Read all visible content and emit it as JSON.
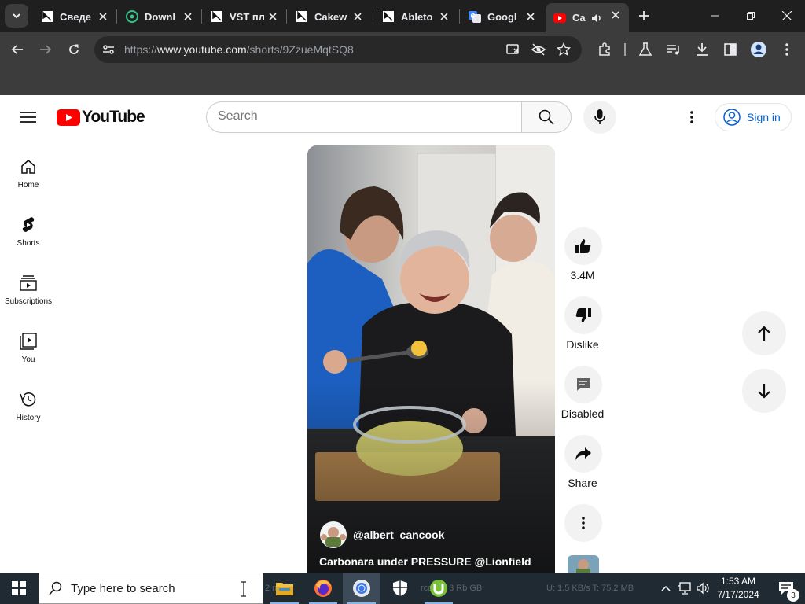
{
  "browser": {
    "tabs": [
      {
        "label": "Сведе",
        "icon": "cursor-app-icon"
      },
      {
        "label": "Downl",
        "icon": "green-circle-icon"
      },
      {
        "label": "VST пл",
        "icon": "cursor-app-icon"
      },
      {
        "label": "Cakew",
        "icon": "cursor-app-icon"
      },
      {
        "label": "Ableto",
        "icon": "cursor-app-icon"
      },
      {
        "label": "Googl",
        "icon": "google-translate-icon"
      },
      {
        "label": "Car",
        "icon": "youtube-icon",
        "active": true,
        "audio": true
      }
    ],
    "url_scheme": "https://",
    "url_host": "www.youtube.com",
    "url_path": "/shorts/9ZzueMqtSQ8"
  },
  "youtube": {
    "logo_text": "YouTube",
    "search_placeholder": "Search",
    "sign_in_label": "Sign in",
    "nav": [
      {
        "label": "Home",
        "icon": "home-icon"
      },
      {
        "label": "Shorts",
        "icon": "shorts-icon"
      },
      {
        "label": "Subscriptions",
        "icon": "subscriptions-icon"
      },
      {
        "label": "You",
        "icon": "you-icon"
      },
      {
        "label": "History",
        "icon": "history-icon"
      }
    ],
    "short": {
      "channel": "@albert_cancook",
      "title": "Carbonara under PRESSURE @Lionfield"
    },
    "actions": {
      "likes": "3.4M",
      "dislike": "Dislike",
      "comments": "Disabled",
      "share": "Share"
    }
  },
  "taskbar": {
    "search_placeholder": "Type here to search",
    "time": "1:53 AM",
    "date": "7/17/2024",
    "notification_count": "3",
    "ghost_left": "2 m",
    "ghost_mid": "rcaEAt 3 Rb GB",
    "ghost_right": "U: 1.5 KB/s T: 75.2 MB"
  },
  "colors": {
    "youtube_red": "#ff0000",
    "link_blue": "#065fd4",
    "chrome_dark": "#1f1f1f",
    "taskbar": "#202a33"
  }
}
